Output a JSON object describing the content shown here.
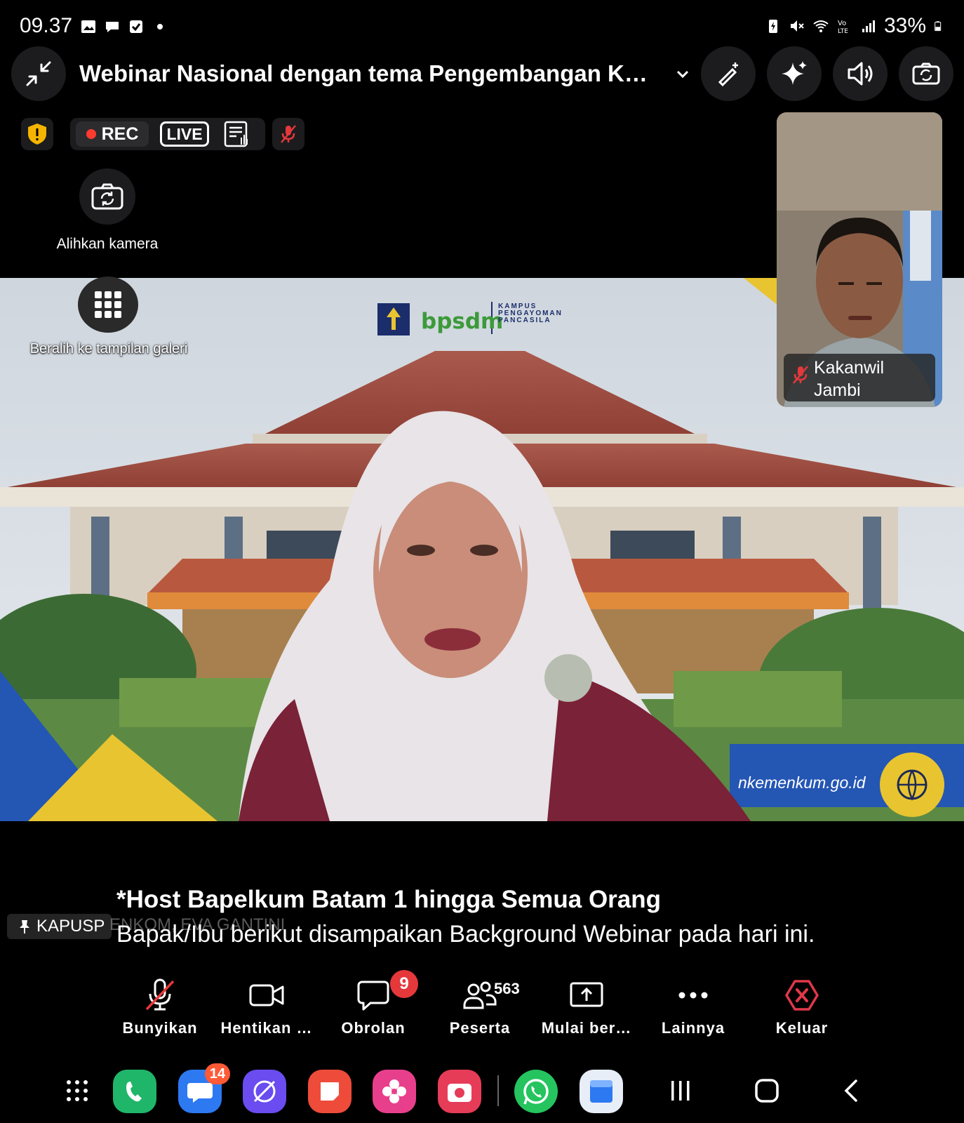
{
  "status_bar": {
    "time": "09.37",
    "battery": "33%",
    "left_icons": [
      "gallery-icon",
      "chat-icon",
      "check-box-icon",
      "dot-icon"
    ],
    "right_icons": [
      "battery-saver-icon",
      "mute-icon",
      "wifi-icon",
      "volte-icon",
      "signal-icon",
      "battery-icon"
    ]
  },
  "header": {
    "title": "Webinar Nasional dengan tema Pengembangan Ko…",
    "minimize_icon": "minimize-icon",
    "title_dropdown_icon": "chevron-down-icon",
    "actions": [
      "annotate-icon",
      "ai-companion-icon",
      "speaker-icon",
      "switch-camera-icon"
    ]
  },
  "meeting_status": {
    "rec_label": "REC",
    "live_label": "LIVE"
  },
  "overlay": {
    "switch_camera_label": "Alihkan kamera",
    "gallery_label": "Beralih ke tampilan galeri"
  },
  "main_video": {
    "logo_text": "bpsdm",
    "logo_subtext": [
      "KAMPUS",
      "PENGAYOMAN",
      "PANCASILA"
    ],
    "website_text": "nkemenkum.go.id"
  },
  "thumbnail": {
    "name": "Kakanwil Jambi"
  },
  "captions": {
    "speaker": "KAPUSP",
    "speaker_faded": "ENKOM, EVA GANTINI",
    "line_1": "*Host Bapelkum Batam 1 hingga Semua Orang",
    "line_2": "Bapak/Ibu berikut disampaikan Background Webinar pada hari ini."
  },
  "toolbar": {
    "unmute": "Bunyikan",
    "stop_video": "Hentikan …",
    "chat": "Obrolan",
    "chat_badge": "9",
    "participants": "Peserta",
    "participants_count": "563",
    "share": "Mulai ber…",
    "more": "Lainnya",
    "leave": "Keluar"
  },
  "dock": {
    "messages_badge": "14",
    "apps": [
      "phone-app-icon",
      "messages-app-icon",
      "internet-app-icon",
      "notes-app-icon",
      "gallery-app-icon",
      "camera-app-icon",
      "whatsapp-app-icon",
      "files-app-icon"
    ]
  },
  "colors": {
    "background": "#000000",
    "record_red": "#ff3b30",
    "badge_red": "#e5383b",
    "leave_red": "#e0384a",
    "dock_badge": "#ff5a36"
  }
}
